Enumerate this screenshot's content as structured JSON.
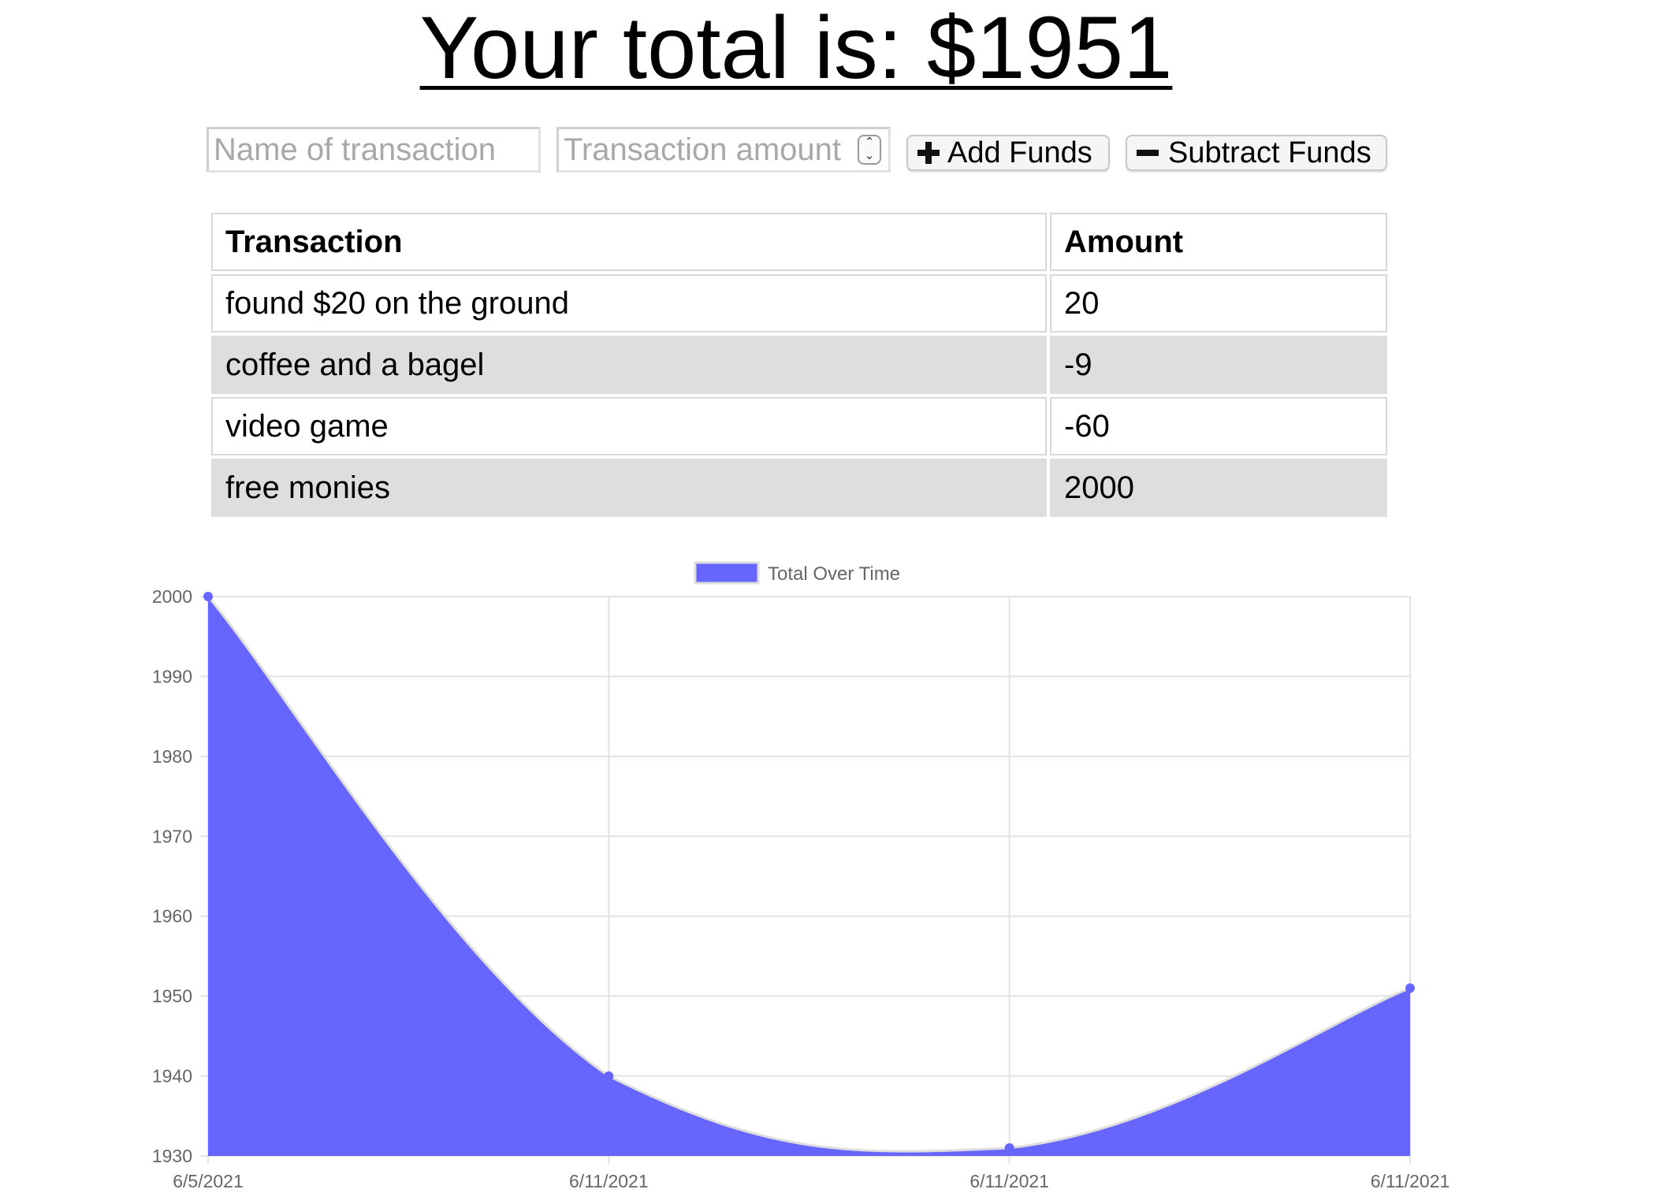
{
  "header": {
    "title": "Your total is: $1951"
  },
  "form": {
    "name_placeholder": "Name of transaction",
    "amount_placeholder": "Transaction amount",
    "add_label": "Add Funds",
    "subtract_label": "Subtract Funds"
  },
  "table": {
    "headers": [
      "Transaction",
      "Amount"
    ],
    "rows": [
      {
        "name": "found $20 on the ground",
        "amount": "20"
      },
      {
        "name": "coffee and a bagel",
        "amount": "-9"
      },
      {
        "name": "video game",
        "amount": "-60"
      },
      {
        "name": "free monies",
        "amount": "2000"
      }
    ]
  },
  "chart_data": {
    "type": "area",
    "legend": "Total Over Time",
    "legend_position": "top-center",
    "categories": [
      "6/5/2021",
      "6/11/2021",
      "6/11/2021",
      "6/11/2021"
    ],
    "values": [
      2000,
      1940,
      1931,
      1951
    ],
    "ylim": [
      1930,
      2000
    ],
    "yticks": [
      1930,
      1940,
      1950,
      1960,
      1970,
      1980,
      1990,
      2000
    ],
    "grid": true,
    "fill_color": "#6666ff",
    "line_color": "#dddddd",
    "point_color": "#6666ff"
  }
}
